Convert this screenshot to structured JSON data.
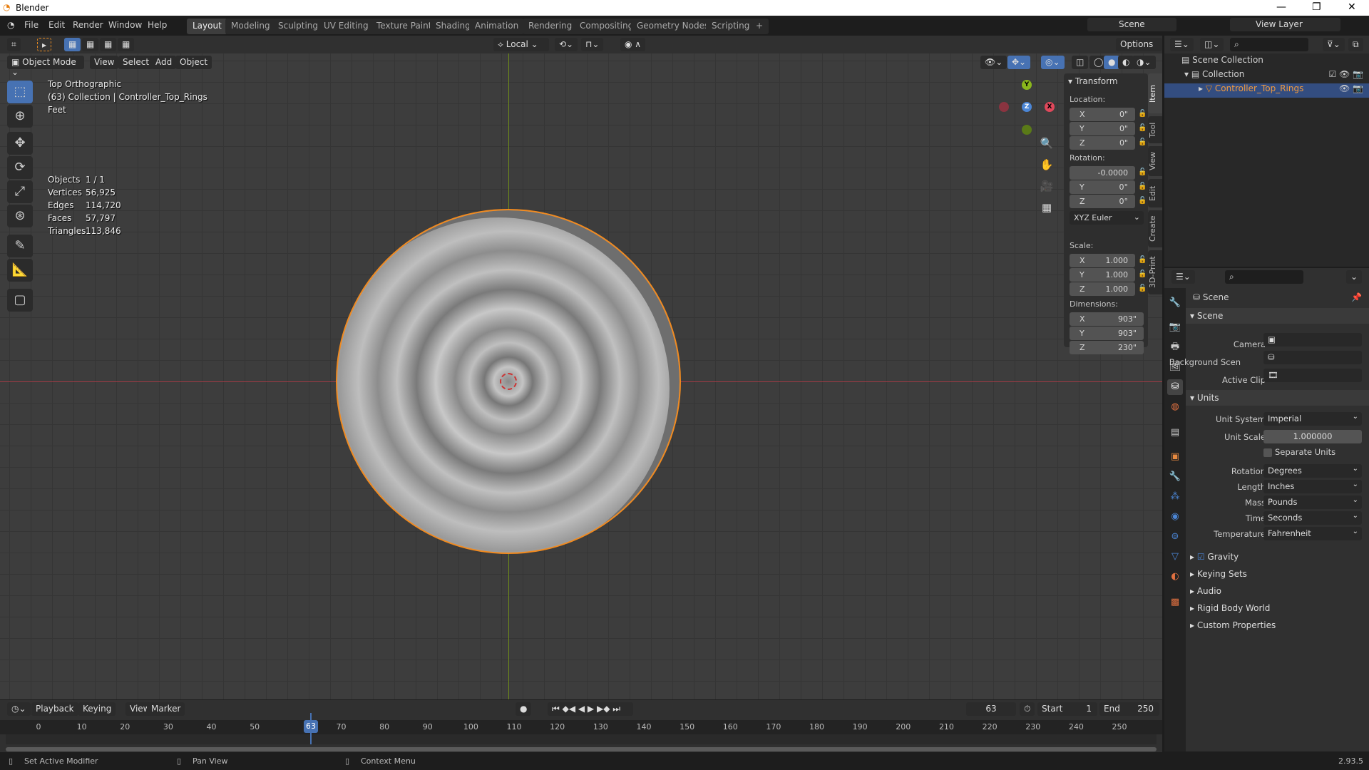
{
  "window": {
    "title": "Blender"
  },
  "menu": [
    "File",
    "Edit",
    "Render",
    "Window",
    "Help"
  ],
  "workspaces": [
    "Layout",
    "Modeling",
    "Sculpting",
    "UV Editing",
    "Texture Paint",
    "Shading",
    "Animation",
    "Rendering",
    "Compositing",
    "Geometry Nodes",
    "Scripting",
    "+"
  ],
  "active_workspace": "Layout",
  "top_right": {
    "scene": "Scene",
    "view_layer": "View Layer"
  },
  "tool_header": {
    "orientation": "Local",
    "options": "Options"
  },
  "viewport_header": {
    "mode": "Object Mode",
    "menus": [
      "View",
      "Select",
      "Add",
      "Object"
    ]
  },
  "overlay": {
    "view": "Top Orthographic",
    "collection": "(63) Collection | Controller_Top_Rings",
    "units": "Feet",
    "stats": [
      {
        "k": "Objects",
        "v": "1 / 1"
      },
      {
        "k": "Vertices",
        "v": "56,925"
      },
      {
        "k": "Edges",
        "v": "114,720"
      },
      {
        "k": "Faces",
        "v": "57,797"
      },
      {
        "k": "Triangles",
        "v": "113,846"
      }
    ]
  },
  "gizmo": {
    "x": "X",
    "y": "Y",
    "z": "Z"
  },
  "npanel": {
    "title": "Transform",
    "location_label": "Location:",
    "location": [
      {
        "ax": "X",
        "v": "0\""
      },
      {
        "ax": "Y",
        "v": "0\""
      },
      {
        "ax": "Z",
        "v": "0\""
      }
    ],
    "rotation_label": "Rotation:",
    "rotation": [
      {
        "ax": "",
        "v": "-0.0000"
      },
      {
        "ax": "Y",
        "v": "0°"
      },
      {
        "ax": "Z",
        "v": "0°"
      }
    ],
    "rotation_mode": "XYZ Euler",
    "scale_label": "Scale:",
    "scale": [
      {
        "ax": "X",
        "v": "1.000"
      },
      {
        "ax": "Y",
        "v": "1.000"
      },
      {
        "ax": "Z",
        "v": "1.000"
      }
    ],
    "dimensions_label": "Dimensions:",
    "dimensions": [
      {
        "ax": "X",
        "v": "903\""
      },
      {
        "ax": "Y",
        "v": "903\""
      },
      {
        "ax": "Z",
        "v": "230\""
      }
    ],
    "tabs": [
      "Item",
      "Tool",
      "View",
      "Edit",
      "Create",
      "3D-Print"
    ]
  },
  "outliner": {
    "root": "Scene Collection",
    "collection": "Collection",
    "object": "Controller_Top_Rings"
  },
  "properties": {
    "context": "Scene",
    "scene_section": "Scene",
    "camera_label": "Camera",
    "background_label": "Background Scen",
    "clip_label": "Active Clip",
    "units_section": "Units",
    "rows": [
      {
        "label": "Unit System",
        "value": "Imperial"
      },
      {
        "label": "Unit Scale",
        "value": "1.000000"
      },
      {
        "label": "Rotation",
        "value": "Degrees"
      },
      {
        "label": "Length",
        "value": "Inches"
      },
      {
        "label": "Mass",
        "value": "Pounds"
      },
      {
        "label": "Time",
        "value": "Seconds"
      },
      {
        "label": "Temperature",
        "value": "Fahrenheit"
      }
    ],
    "separate_units": "Separate Units",
    "collapsed": [
      "Gravity",
      "Keying Sets",
      "Audio",
      "Rigid Body World",
      "Custom Properties"
    ]
  },
  "timeline": {
    "menus": [
      "Playback",
      "Keying",
      "View",
      "Marker"
    ],
    "current_frame": 63,
    "current_frame_label": "63",
    "start_label": "Start",
    "start": "1",
    "end_label": "End",
    "end": "250",
    "ticks": [
      0,
      10,
      20,
      30,
      40,
      50,
      60,
      70,
      80,
      90,
      100,
      110,
      120,
      130,
      140,
      150,
      160,
      170,
      180,
      190,
      200,
      210,
      220,
      230,
      240,
      250
    ]
  },
  "status": {
    "left": "Set Active Modifier",
    "mid": "Pan View",
    "right": "Context Menu",
    "version": "2.93.5"
  },
  "colors": {
    "accent": "#4772b3",
    "selection": "#f08a20",
    "x_axis": "#a33c45",
    "y_axis": "#6d8a1a"
  }
}
